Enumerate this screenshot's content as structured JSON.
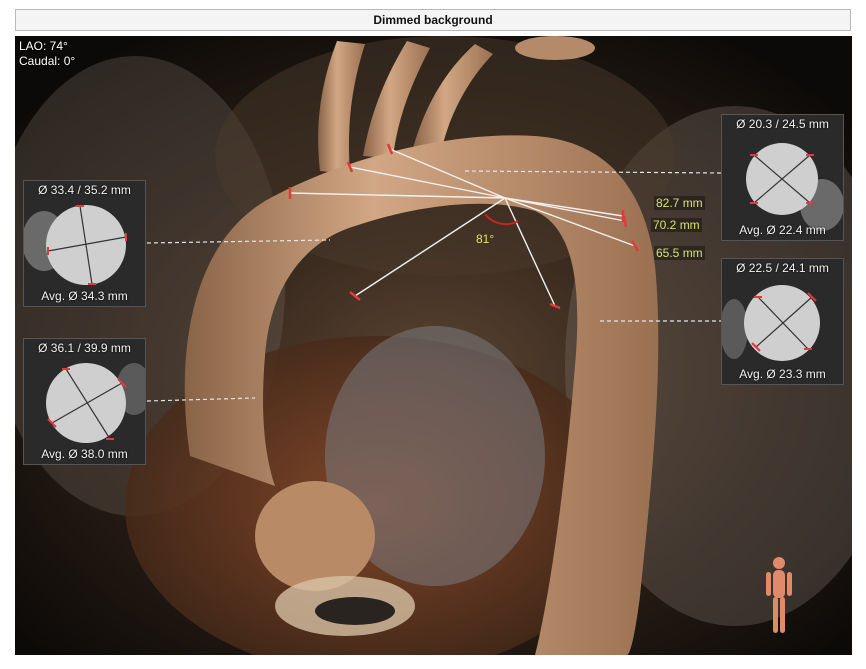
{
  "header": {
    "title": "Dimmed background"
  },
  "orientation": {
    "lao": "LAO: 74°",
    "caudal": "Caudal: 0°"
  },
  "cross_sections": {
    "left_upper": {
      "diameters": "Ø 33.4 / 35.2 mm",
      "average": "Avg. Ø 34.3 mm"
    },
    "left_lower": {
      "diameters": "Ø 36.1 / 39.9 mm",
      "average": "Avg. Ø 38.0 mm"
    },
    "right_upper": {
      "diameters": "Ø 20.3 / 24.5 mm",
      "average": "Avg. Ø 22.4 mm"
    },
    "right_lower": {
      "diameters": "Ø 22.5 / 24.1 mm",
      "average": "Avg. Ø 23.3 mm"
    }
  },
  "measurements": {
    "length_1": "82.7 mm",
    "length_2": "70.2 mm",
    "length_3": "65.5 mm",
    "angle": "81°"
  },
  "colors": {
    "measure_text": "#d9e36a",
    "marker_red": "#e03a3a",
    "angle_arc": "#cc2222",
    "aorta": "#c79a72"
  },
  "icons": {
    "patient_figure": "human-figure-icon"
  }
}
